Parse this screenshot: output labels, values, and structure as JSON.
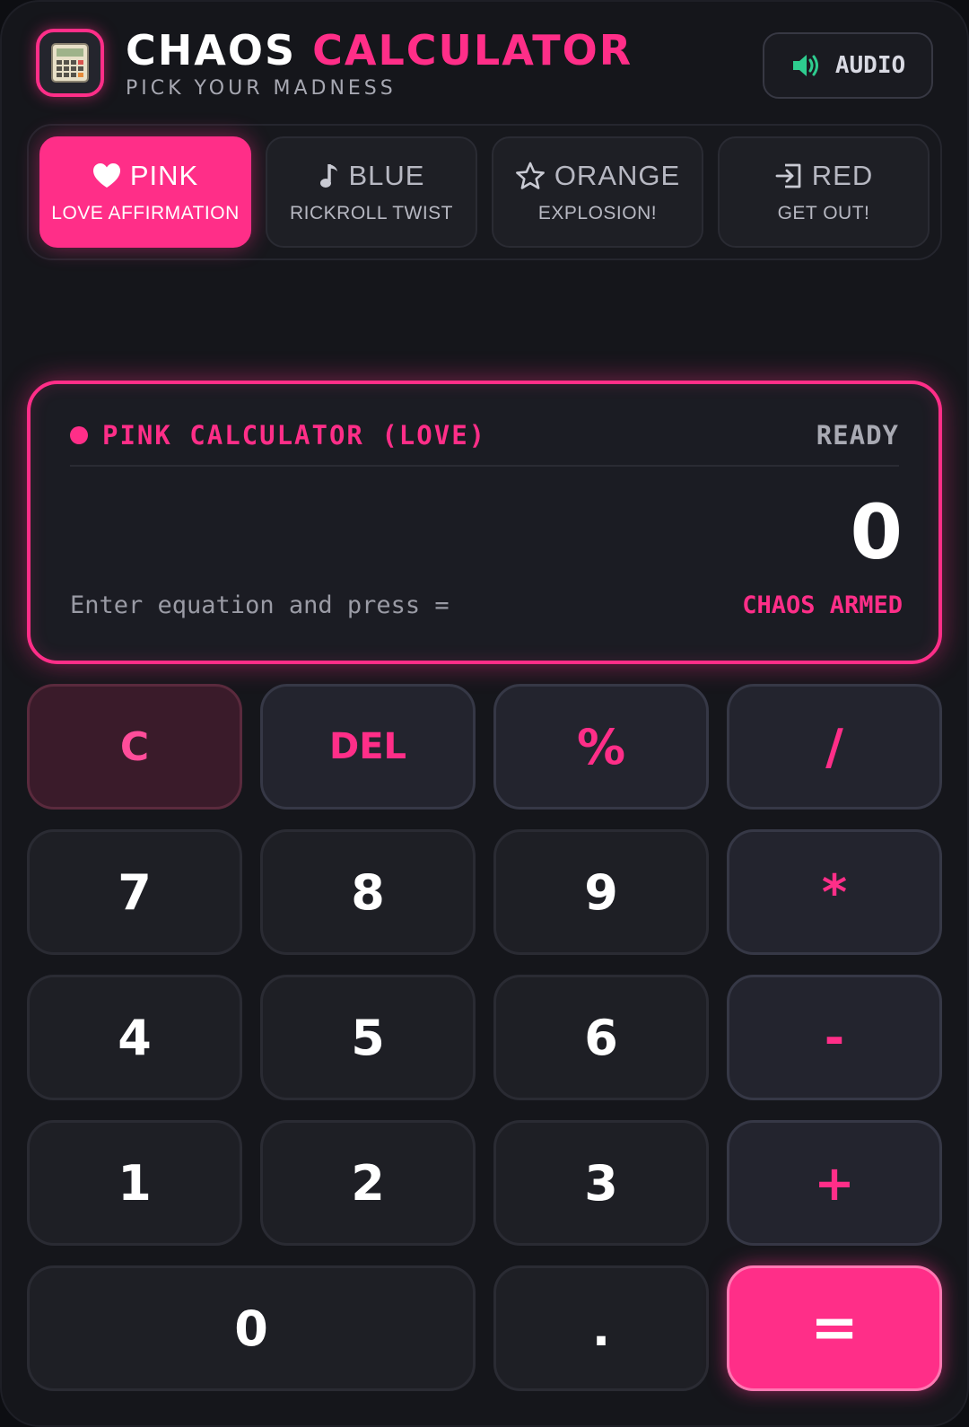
{
  "header": {
    "title_word1": "CHAOS",
    "title_word2": "CALCULATOR",
    "subtitle": "PICK YOUR MADNESS",
    "app_icon": "calculator-icon",
    "audio": {
      "label": "AUDIO",
      "icon": "speaker-icon"
    }
  },
  "modes": [
    {
      "icon": "heart-icon",
      "label": "PINK",
      "sub": "LOVE AFFIRMATION",
      "active": true
    },
    {
      "icon": "music-note-icon",
      "label": "BLUE",
      "sub": "RICKROLL TWIST",
      "active": false
    },
    {
      "icon": "star-icon",
      "label": "ORANGE",
      "sub": "EXPLOSION!",
      "active": false
    },
    {
      "icon": "exit-icon",
      "label": "RED",
      "sub": "GET OUT!",
      "active": false
    }
  ],
  "display": {
    "mode_label": "PINK CALCULATOR (LOVE)",
    "status": "READY",
    "value": "0",
    "hint": "Enter equation and press =",
    "armed": "CHAOS ARMED"
  },
  "keys": {
    "clear": "C",
    "del": "DEL",
    "percent": "%",
    "divide": "/",
    "seven": "7",
    "eight": "8",
    "nine": "9",
    "multiply": "*",
    "four": "4",
    "five": "5",
    "six": "6",
    "minus": "-",
    "one": "1",
    "two": "2",
    "three": "3",
    "plus": "+",
    "zero": "0",
    "dot": ".",
    "equals": "="
  },
  "colors": {
    "accent": "#ff2e88",
    "background": "#15161b",
    "speaker": "#2ecc8f"
  }
}
